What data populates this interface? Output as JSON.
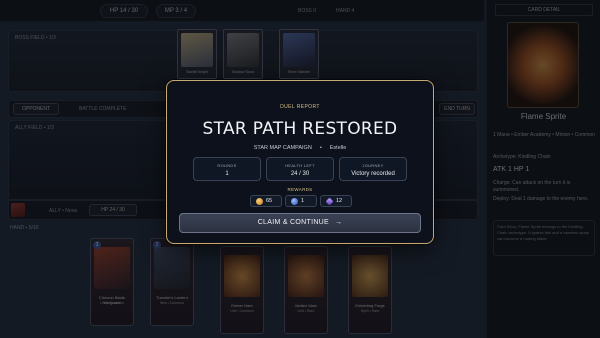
{
  "topbar": {
    "hp": "HP 14 / 30",
    "mp": "MP 3 / 4",
    "turn": "BOSS II",
    "hand": "HAND 4"
  },
  "board": {
    "enemy_field_label": "BOSS FIELD • 1/3",
    "opponent_button": "OPPONENT",
    "battle_status": "BATTLE COMPLETE",
    "end_turn_label": "END TURN",
    "ally_field_label": "ALLY FIELD • 1/3",
    "player_name": "ALLY • Nova",
    "player_hp": "HP 24 / 30",
    "hand_label": "HAND • 5/10",
    "enemy_cards": [
      "Starfall Knight",
      "Shadow Scout",
      "Storm Warden"
    ],
    "hand_cards": [
      {
        "name": "Crimson Blade Vanguard",
        "sub": "Unit • Common",
        "cost": "3"
      },
      {
        "name": "Traveler's Lantern",
        "sub": "Item • Common",
        "cost": "2"
      },
      {
        "name": "Ember Hare",
        "sub": "Unit • Common",
        "cost": ""
      },
      {
        "name": "Molten Maw",
        "sub": "Unit • Rare",
        "cost": ""
      },
      {
        "name": "Emberling Forge",
        "sub": "Spell • Rare",
        "cost": ""
      }
    ]
  },
  "sidebar": {
    "header": "CARD DETAIL",
    "card_name": "Flame Sprite",
    "type_line": "1 Mana • Ember Academy • Minion • Common",
    "archetype": "Archetype: Kindling Chain",
    "stats": "ATK 1   HP 1",
    "ability1": "Charge: Can attack on the turn it is summoned.",
    "ability2": "Deploy: Deal 1 damage to the enemy hero.",
    "flavor": "Card Story: Flame Sprite belongs to the Kindling Chain archetype. It sparks first and a careless spark can become a roaring blaze."
  },
  "modal": {
    "label": "DUEL REPORT",
    "title": "STAR PATH RESTORED",
    "campaign": "STAR MAP CAMPAIGN",
    "separator": "•",
    "player": "Estelle",
    "stats": [
      {
        "key": "ROUNDS",
        "value": "1"
      },
      {
        "key": "HEALTH LEFT",
        "value": "24 / 30"
      },
      {
        "key": "JOURNEY",
        "value": "Victory recorded"
      }
    ],
    "rewards_label": "REWARDS",
    "rewards": [
      {
        "icon": "gold-coin-icon",
        "value": "65",
        "color": "#e0a23a"
      },
      {
        "icon": "star-crystal-icon",
        "value": "1",
        "color": "#4a7ae0"
      },
      {
        "icon": "gem-shard-icon",
        "value": "12",
        "color": "#8a6ae0"
      }
    ],
    "claim_label": "CLAIM & CONTINUE",
    "claim_arrow": "→"
  }
}
